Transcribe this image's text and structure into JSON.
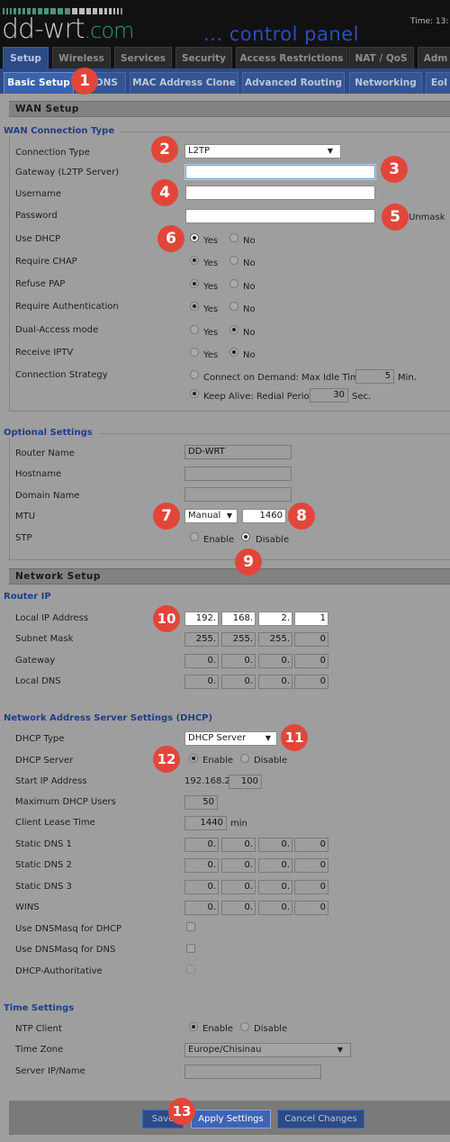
{
  "header": {
    "logo_main": "dd-wrt",
    "logo_suffix": ".com",
    "tagline": "... control panel",
    "time_label": "Time: 13:"
  },
  "main_tabs": [
    {
      "label": "Setup",
      "active": true
    },
    {
      "label": "Wireless",
      "active": false
    },
    {
      "label": "Services",
      "active": false
    },
    {
      "label": "Security",
      "active": false
    },
    {
      "label": "Access Restrictions",
      "active": false
    },
    {
      "label": "NAT / QoS",
      "active": false
    },
    {
      "label": "Adm",
      "active": false
    }
  ],
  "sub_tabs": [
    {
      "label": "Basic Setup",
      "active": true
    },
    {
      "label": "DDNS",
      "active": false
    },
    {
      "label": "MAC Address Clone",
      "active": false
    },
    {
      "label": "Advanced Routing",
      "active": false
    },
    {
      "label": "Networking",
      "active": false
    },
    {
      "label": "EoI",
      "active": false
    }
  ],
  "wan_setup": {
    "title": "WAN Setup",
    "connection_type_legend": "WAN Connection Type",
    "connection_type": {
      "label": "Connection Type",
      "value": "L2TP"
    },
    "gateway": {
      "label": "Gateway (L2TP Server)",
      "value": ""
    },
    "username": {
      "label": "Username",
      "value": ""
    },
    "password": {
      "label": "Password",
      "value": "",
      "unmask_label": "Unmask"
    },
    "yes_label": "Yes",
    "no_label": "No",
    "radio_rows": [
      {
        "label": "Use DHCP",
        "value": "Yes"
      },
      {
        "label": "Require CHAP",
        "value": "Yes"
      },
      {
        "label": "Refuse PAP",
        "value": "Yes"
      },
      {
        "label": "Require Authentication",
        "value": "Yes"
      },
      {
        "label": "Dual-Access mode",
        "value": "No"
      },
      {
        "label": "Receive IPTV",
        "value": "No"
      }
    ],
    "connection_strategy": {
      "label": "Connection Strategy",
      "on_demand_label": "Connect on Demand: Max Idle Time",
      "max_idle_time": "5",
      "min_unit": "Min.",
      "keep_alive_label": "Keep Alive: Redial Period",
      "redial_period": "30",
      "sec_unit": "Sec.",
      "selected": "Keep Alive"
    }
  },
  "optional_settings": {
    "legend": "Optional Settings",
    "router_name": {
      "label": "Router Name",
      "value": "DD-WRT"
    },
    "hostname": {
      "label": "Hostname",
      "value": ""
    },
    "domain_name": {
      "label": "Domain Name",
      "value": ""
    },
    "mtu": {
      "label": "MTU",
      "mode": "Manual",
      "value": "1460"
    },
    "stp": {
      "label": "STP",
      "enable_label": "Enable",
      "disable_label": "Disable",
      "value": "Disable"
    }
  },
  "network_setup": {
    "title": "Network Setup",
    "router_ip_legend": "Router IP",
    "local_ip": {
      "label": "Local IP Address",
      "octets": [
        "192",
        "168",
        "2",
        "1"
      ]
    },
    "subnet_mask": {
      "label": "Subnet Mask",
      "octets": [
        "255",
        "255",
        "255",
        "0"
      ]
    },
    "gateway": {
      "label": "Gateway",
      "octets": [
        "0",
        "0",
        "0",
        "0"
      ]
    },
    "local_dns": {
      "label": "Local DNS",
      "octets": [
        "0",
        "0",
        "0",
        "0"
      ]
    }
  },
  "dhcp": {
    "legend": "Network Address Server Settings (DHCP)",
    "dhcp_type": {
      "label": "DHCP Type",
      "value": "DHCP Server"
    },
    "dhcp_server": {
      "label": "DHCP Server",
      "enable_label": "Enable",
      "disable_label": "Disable",
      "value": "Enable"
    },
    "start_ip": {
      "label": "Start IP Address",
      "prefix": "192.168.2.",
      "value": "100"
    },
    "max_users": {
      "label": "Maximum DHCP Users",
      "value": "50"
    },
    "lease_time": {
      "label": "Client Lease Time",
      "value": "1440",
      "unit": "min"
    },
    "static_dns1": {
      "label": "Static DNS 1",
      "octets": [
        "0",
        "0",
        "0",
        "0"
      ]
    },
    "static_dns2": {
      "label": "Static DNS 2",
      "octets": [
        "0",
        "0",
        "0",
        "0"
      ]
    },
    "static_dns3": {
      "label": "Static DNS 3",
      "octets": [
        "0",
        "0",
        "0",
        "0"
      ]
    },
    "wins": {
      "label": "WINS",
      "octets": [
        "0",
        "0",
        "0",
        "0"
      ]
    },
    "dnsmasq_dhcp": {
      "label": "Use DNSMasq for DHCP",
      "checked": false
    },
    "dnsmasq_dns": {
      "label": "Use DNSMasq for DNS",
      "checked": false
    },
    "authoritative": {
      "label": "DHCP-Authoritative",
      "checked": false
    }
  },
  "time_settings": {
    "legend": "Time Settings",
    "ntp_client": {
      "label": "NTP Client",
      "enable_label": "Enable",
      "disable_label": "Disable",
      "value": "Enable"
    },
    "time_zone": {
      "label": "Time Zone",
      "value": "Europe/Chisinau"
    },
    "server": {
      "label": "Server IP/Name",
      "value": ""
    }
  },
  "footer": {
    "save_label": "Save",
    "apply_label": "Apply Settings",
    "cancel_label": "Cancel Changes"
  },
  "annotations": [
    "1",
    "2",
    "3",
    "4",
    "5",
    "6",
    "7",
    "8",
    "9",
    "10",
    "11",
    "12",
    "13"
  ],
  "colors": {
    "accent_blue": "#2c4a86",
    "legend_blue": "#1f3e86",
    "badge_red": "#e2463a",
    "logo_teal": "#3d8f7c"
  }
}
